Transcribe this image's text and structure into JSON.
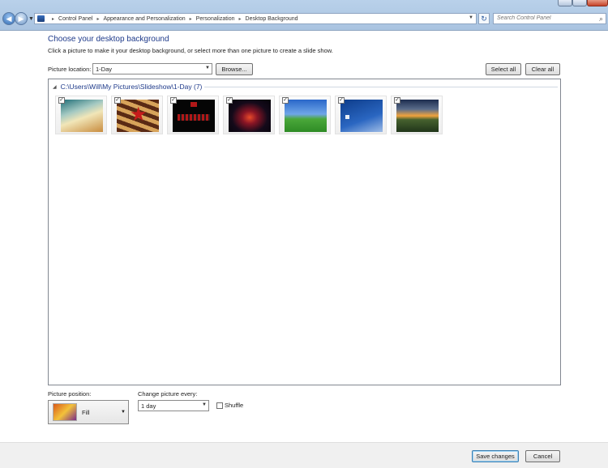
{
  "window": {
    "controls": {
      "minimize": "‒",
      "maximize": "□",
      "close": "✕"
    }
  },
  "nav": {
    "back_icon": "arrow-left-icon",
    "forward_icon": "arrow-right-icon"
  },
  "address": {
    "breadcrumbs": [
      "Control Panel",
      "Appearance and Personalization",
      "Personalization",
      "Desktop Background"
    ]
  },
  "search": {
    "placeholder": "Search Control Panel"
  },
  "page": {
    "title": "Choose your desktop background",
    "subtitle": "Click a picture to make it your desktop background, or select more than one picture to create a slide show."
  },
  "location": {
    "label": "Picture location:",
    "value": "1-Day",
    "browse_label": "Browse..."
  },
  "selection": {
    "select_all_label": "Select all",
    "clear_all_label": "Clear all"
  },
  "gallery": {
    "group_title": "C:\\Users\\Will\\My Pictures\\Slideshow\\1-Day (7)",
    "thumbnails": [
      {
        "name": "abstract-light-swirl",
        "checked": true
      },
      {
        "name": "red-star-rays",
        "checked": true
      },
      {
        "name": "team-photo-black",
        "checked": true
      },
      {
        "name": "red-wave-dark",
        "checked": true
      },
      {
        "name": "green-hill-blue-sky",
        "checked": true
      },
      {
        "name": "blue-logo-wave",
        "checked": true
      },
      {
        "name": "sunset-landscape",
        "checked": true
      }
    ]
  },
  "position": {
    "label": "Picture position:",
    "value": "Fill"
  },
  "change": {
    "label": "Change picture every:",
    "value": "1 day"
  },
  "shuffle": {
    "label": "Shuffle",
    "checked": false
  },
  "footer": {
    "save_label": "Save changes",
    "cancel_label": "Cancel"
  }
}
